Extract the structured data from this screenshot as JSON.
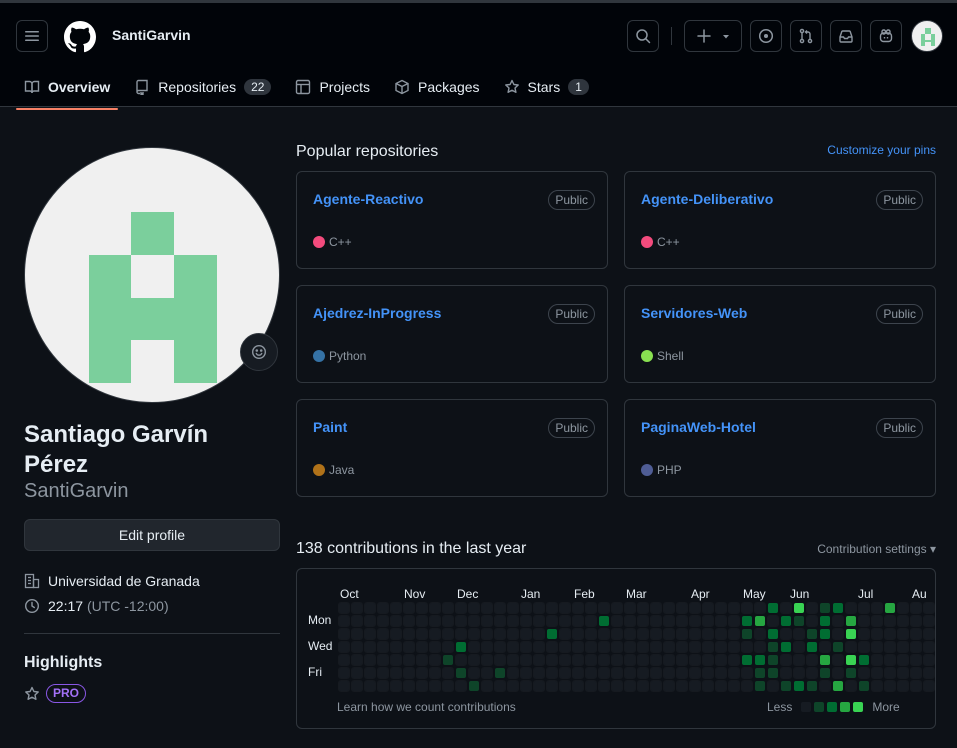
{
  "header": {
    "username": "SantiGarvin"
  },
  "tabs": [
    {
      "label": "Overview",
      "icon": "book-icon"
    },
    {
      "label": "Repositories",
      "icon": "repo-icon",
      "count": "22"
    },
    {
      "label": "Projects",
      "icon": "table-icon"
    },
    {
      "label": "Packages",
      "icon": "package-icon"
    },
    {
      "label": "Stars",
      "icon": "star-icon",
      "count": "1"
    }
  ],
  "profile": {
    "full_name": "Santiago Garvín Pérez",
    "login": "SantiGarvin",
    "edit_label": "Edit profile",
    "organization": "Universidad de Granada",
    "local_time": "22:17",
    "timezone": "(UTC -12:00)",
    "highlights_title": "Highlights",
    "pro_badge": "PRO"
  },
  "popular": {
    "title": "Popular repositories",
    "customize": "Customize your pins",
    "repos": [
      {
        "name": "Agente-Reactivo",
        "visibility": "Public",
        "language": "C++",
        "color": "#f34b7d"
      },
      {
        "name": "Agente-Deliberativo",
        "visibility": "Public",
        "language": "C++",
        "color": "#f34b7d"
      },
      {
        "name": "Ajedrez-InProgress",
        "visibility": "Public",
        "language": "Python",
        "color": "#3572A5"
      },
      {
        "name": "Servidores-Web",
        "visibility": "Public",
        "language": "Shell",
        "color": "#89e051"
      },
      {
        "name": "Paint",
        "visibility": "Public",
        "language": "Java",
        "color": "#b07219"
      },
      {
        "name": "PaginaWeb-Hotel",
        "visibility": "Public",
        "language": "PHP",
        "color": "#4F5D95"
      }
    ]
  },
  "contributions": {
    "title": "138 contributions in the last year",
    "settings_label": "Contribution settings",
    "months": [
      "Oct",
      "Nov",
      "Dec",
      "Jan",
      "Feb",
      "Mar",
      "Apr",
      "May",
      "Jun",
      "Jul",
      "Au"
    ],
    "days": [
      "Mon",
      "Wed",
      "Fri"
    ],
    "learn_label": "Learn how we count contributions",
    "legend_less": "Less",
    "legend_more": "More",
    "level_colors": [
      "#161b22",
      "#0e4429",
      "#006d32",
      "#26a641",
      "#39d353"
    ],
    "weeks": 46,
    "active_cells": [
      [
        8,
        4,
        1
      ],
      [
        9,
        3,
        2
      ],
      [
        9,
        5,
        1
      ],
      [
        10,
        6,
        1
      ],
      [
        12,
        5,
        1
      ],
      [
        16,
        2,
        2
      ],
      [
        20,
        1,
        2
      ],
      [
        31,
        1,
        2
      ],
      [
        31,
        2,
        1
      ],
      [
        31,
        4,
        2
      ],
      [
        32,
        1,
        3
      ],
      [
        32,
        4,
        2
      ],
      [
        32,
        5,
        1
      ],
      [
        32,
        6,
        1
      ],
      [
        33,
        0,
        2
      ],
      [
        33,
        2,
        2
      ],
      [
        33,
        3,
        1
      ],
      [
        33,
        4,
        1
      ],
      [
        33,
        5,
        1
      ],
      [
        34,
        1,
        2
      ],
      [
        34,
        3,
        2
      ],
      [
        34,
        6,
        1
      ],
      [
        35,
        0,
        4
      ],
      [
        35,
        1,
        1
      ],
      [
        35,
        6,
        2
      ],
      [
        36,
        2,
        1
      ],
      [
        36,
        3,
        2
      ],
      [
        36,
        6,
        1
      ],
      [
        37,
        0,
        1
      ],
      [
        37,
        1,
        2
      ],
      [
        37,
        2,
        2
      ],
      [
        37,
        4,
        3
      ],
      [
        37,
        5,
        1
      ],
      [
        38,
        0,
        2
      ],
      [
        38,
        3,
        1
      ],
      [
        38,
        6,
        3
      ],
      [
        39,
        1,
        3
      ],
      [
        39,
        2,
        4
      ],
      [
        39,
        4,
        4
      ],
      [
        39,
        5,
        1
      ],
      [
        40,
        4,
        2
      ],
      [
        40,
        6,
        1
      ],
      [
        42,
        0,
        3
      ]
    ]
  }
}
